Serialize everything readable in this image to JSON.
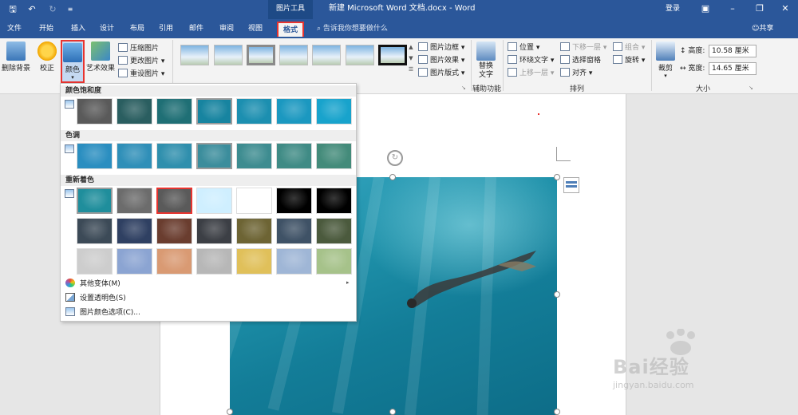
{
  "titlebar": {
    "contextual_group": "图片工具",
    "doc_title": "新建 Microsoft Word 文档.docx - Word",
    "login": "登录"
  },
  "tabs": [
    {
      "label": "文件"
    },
    {
      "label": "开始"
    },
    {
      "label": "插入"
    },
    {
      "label": "设计"
    },
    {
      "label": "布局"
    },
    {
      "label": "引用"
    },
    {
      "label": "邮件"
    },
    {
      "label": "审阅"
    },
    {
      "label": "视图"
    },
    {
      "label": "格式",
      "active": true
    }
  ],
  "tellme": "告诉我你想要做什么",
  "share": "共享",
  "ribbon": {
    "remove_bg": "删除背景",
    "correct": "校正",
    "color": "颜色",
    "art_effects": "艺术效果",
    "compress": "压缩图片",
    "change_pic": "更改图片",
    "reset_pic": "重设图片",
    "pic_border": "图片边框",
    "pic_effects": "图片效果",
    "pic_layout": "图片版式",
    "alt_text_line1": "替换",
    "alt_text_line2": "文字",
    "accessibility_group": "辅助功能",
    "position": "位置",
    "wrap_text": "环绕文字",
    "bring_forward": "上移一层",
    "send_backward": "下移一层",
    "selection_pane": "选择窗格",
    "align": "对齐",
    "group": "组合",
    "rotate": "旋转",
    "arrange_group": "排列",
    "crop": "裁剪",
    "height_label": "高度:",
    "height_value": "10.58 厘米",
    "width_label": "宽度:",
    "width_value": "14.65 厘米",
    "size_group": "大小"
  },
  "color_panel": {
    "saturation_header": "颜色饱和度",
    "tone_header": "色调",
    "recolor_header": "重新着色",
    "more_variants": "其他变体(M)",
    "set_transparent": "设置透明色(S)",
    "color_options": "图片颜色选项(C)...",
    "saturation_swatches": [
      "#5a5a5a",
      "#2a5e60",
      "#1f6f75",
      "#1784a0",
      "#1c8fb0",
      "#1b98c0",
      "#18a3cc"
    ],
    "tone_swatches": [
      "#2a8ec0",
      "#2f8fb8",
      "#2f8fad",
      "#3b8d9c",
      "#3d8c90",
      "#3f8b85",
      "#438b7a"
    ],
    "recolor_row1": [
      "#1f8e9c",
      "#6c6c6c",
      "#5a5a5a",
      "#cfefff",
      "#ffffff",
      "#000000",
      "#000000"
    ],
    "recolor_row2": [
      "#3c4a57",
      "#2f4062",
      "#6a3d2f",
      "#3c3f45",
      "#6d6434",
      "#3f5266",
      "#4b5a3d"
    ],
    "recolor_row3": [
      "#cdcdcd",
      "#8ba4d2",
      "#d99a73",
      "#b7b7b7",
      "#e0c05a",
      "#9fb6d6",
      "#a6c28a"
    ]
  },
  "watermark": {
    "brand": "Bai经验",
    "url": "jingyan.baidu.com"
  }
}
